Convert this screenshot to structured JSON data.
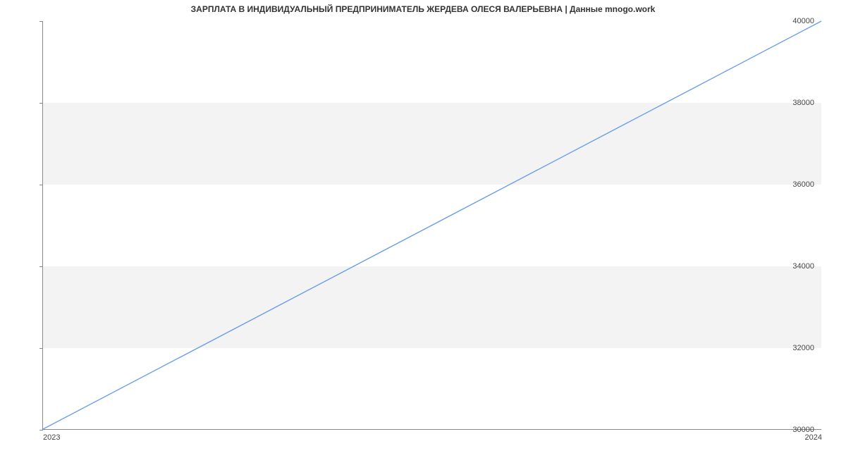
{
  "chart_data": {
    "type": "line",
    "title": "ЗАРПЛАТА В ИНДИВИДУАЛЬНЫЙ ПРЕДПРИНИМАТЕЛЬ ЖЕРДЕВА ОЛЕСЯ ВАЛЕРЬЕВНА | Данные mnogo.work",
    "xlabel": "",
    "ylabel": "",
    "x": [
      "2023",
      "2024"
    ],
    "values": [
      30000,
      40000
    ],
    "x_ticks": [
      "2023",
      "2024"
    ],
    "y_ticks": [
      30000,
      32000,
      34000,
      36000,
      38000,
      40000
    ],
    "ylim": [
      30000,
      40000
    ],
    "line_color": "#6a9ee8",
    "band_color": "#f3f3f3",
    "plot_bands": [
      [
        32000,
        34000
      ],
      [
        36000,
        38000
      ]
    ]
  }
}
